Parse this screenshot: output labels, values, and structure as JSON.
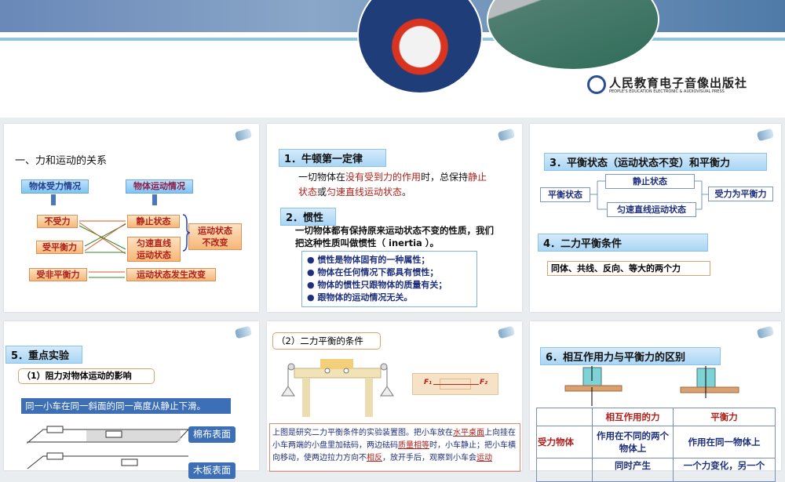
{
  "header": {
    "publisher_cn": "人民教育电子音像出版社",
    "publisher_en": "PEOPLE'S EDUCATION ELECTRONIC & AUDIOVISUAL PRESS"
  },
  "slide1": {
    "title": "一、力和运动的关系",
    "col_force": "物体受力情况",
    "col_motion": "物体运动情况",
    "no_force": "不受力",
    "balanced": "受平衡力",
    "unbalanced": "受非平衡力",
    "rest": "静止状态",
    "uniform": "匀速直线运动状态",
    "unchanged": "运动状态不改变",
    "changed": "运动状态发生改变"
  },
  "slide2": {
    "h1": "1．牛顿第一定律",
    "law_a": "一切物体在",
    "law_b": "没有受到力的作用",
    "law_c": "时，总保持",
    "law_d": "静止状态",
    "law_e": "或",
    "law_f": "匀速直线运动状态",
    "law_g": "。",
    "h2": "2．惯性",
    "inertia_def": "一切物体都有保持原来运动状态不变的性质，我们把这种性质叫做惯性（ inertia ）。",
    "bullets": [
      "惯性是物体固有的一种属性；",
      "物体在任何情况下都具有惯性；",
      "物体的惯性只跟物体的质量有关；",
      "跟物体的运动情况无关。"
    ]
  },
  "slide3": {
    "h3": "3．平衡状态（运动状态不变）和平衡力",
    "state": "平衡状态",
    "rest": "静止状态",
    "uniform": "匀速直线运动状态",
    "balanced_force": "受力为平衡力",
    "h4": "4．二力平衡条件",
    "conditions": "同体、共线、反向、等大的两个力"
  },
  "slide4": {
    "h5": "5．重点实验",
    "sub1": "（1）阻力对物体运动的影响",
    "instruction": "同一小车在同一斜面的同一高度从静止下滑。",
    "surface1": "棉布表面",
    "surface2": "木板表面"
  },
  "slide5": {
    "sub2": "（2）二力平衡的条件",
    "f1": "F₁",
    "f2": "F₂",
    "p1": "上图是研究二力平衡条件的实验装置图。把小车放在",
    "a1": "水平桌面",
    "p2": "上向挂在小车两端的小盘里加砝码，两边砝码",
    "a2": "质量相等",
    "p3": "时，小车静止；把小车横向移动，使两边拉力方向不",
    "a3": "相反",
    "p4": "，放开手后，观察到小车会",
    "a4": "运动"
  },
  "slide6": {
    "h6": "6．相互作用力与平衡力的区别",
    "th1": "相互作用的力",
    "th2": "平衡力",
    "r1": "受力物体",
    "r1c1": "作用在不同的两个物体上",
    "r1c2": "作用在同一物体上",
    "r2c1": "同时产生",
    "r2c2": "一个力变化，另一个"
  }
}
